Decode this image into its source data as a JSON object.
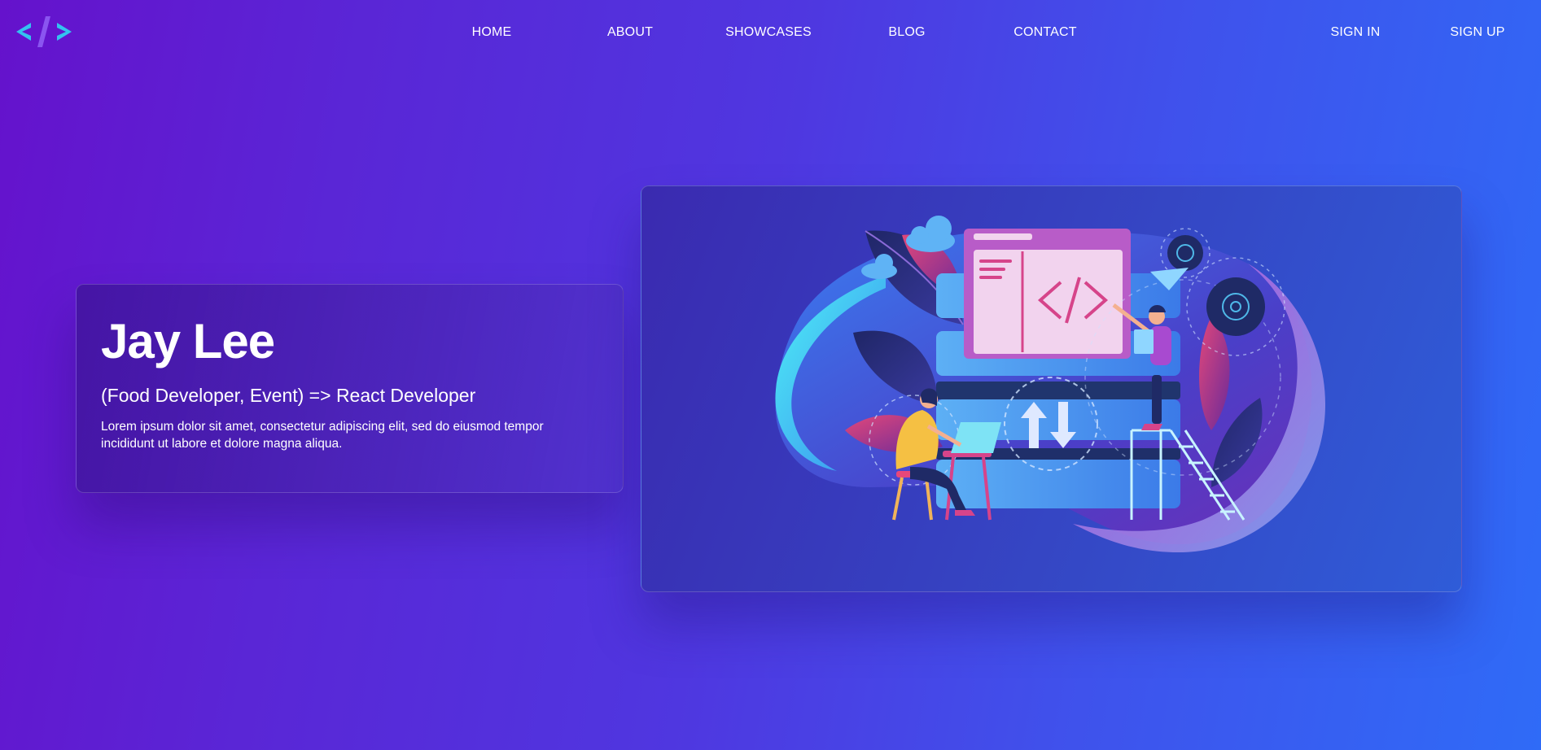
{
  "nav": {
    "logo_icon": "code-brackets-icon",
    "links": [
      {
        "label": "HOME"
      },
      {
        "label": "ABOUT"
      },
      {
        "label": "SHOWCASES"
      },
      {
        "label": "BLOG"
      },
      {
        "label": "CONTACT"
      }
    ],
    "auth": {
      "sign_in": "SIGN IN",
      "sign_up": "SIGN UP"
    }
  },
  "hero": {
    "name": "Jay Lee",
    "role": "(Food Developer, Event) => React Developer",
    "description": "Lorem ipsum dolor sit amet, consectetur adipiscing elit, sed do eiusmod tempor incididunt ut labore et dolore magna aliqua.",
    "illustration": "developers-coding-illustration"
  },
  "colors": {
    "gradient_start": "#6512cc",
    "gradient_end": "#2f6bf7",
    "logo_cyan": "#33c3f0",
    "logo_violet": "#8a55f0"
  }
}
